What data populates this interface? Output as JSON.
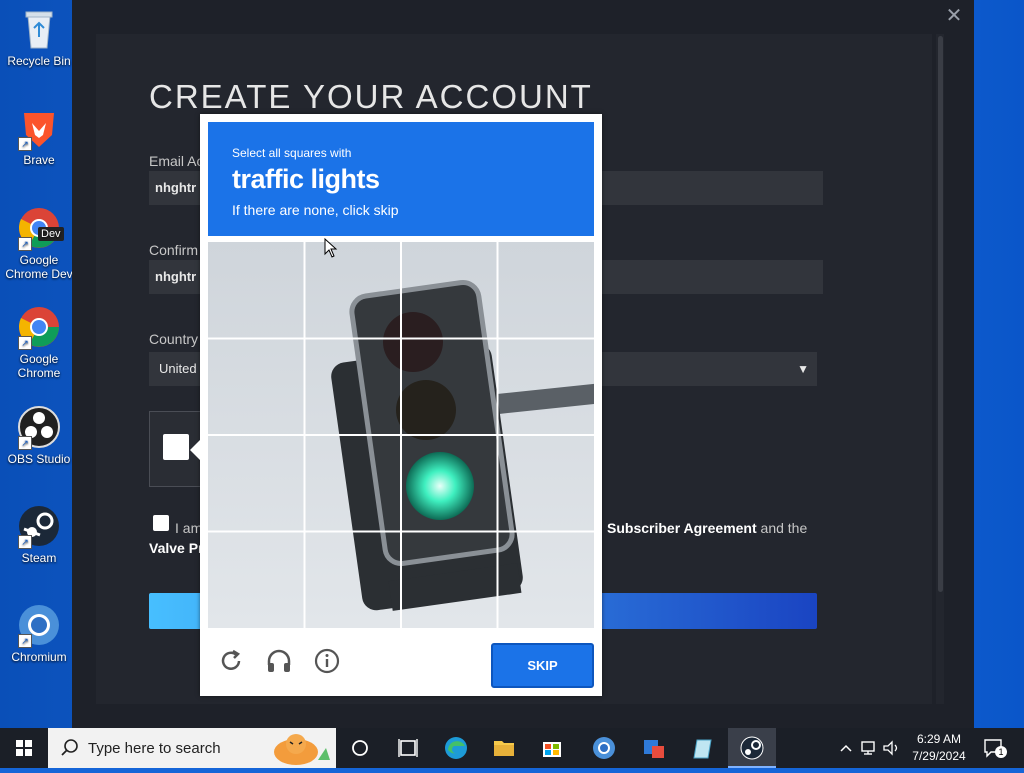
{
  "desktop": {
    "icons": [
      {
        "label_lines": [
          "Recycle Bin"
        ]
      },
      {
        "label_lines": [
          "Brave"
        ]
      },
      {
        "label_lines": [
          "Google",
          "Chrome Dev"
        ],
        "badge": "Dev"
      },
      {
        "label_lines": [
          "Google",
          "Chrome"
        ]
      },
      {
        "label_lines": [
          "OBS Studio"
        ]
      },
      {
        "label_lines": [
          "Steam"
        ]
      },
      {
        "label_lines": [
          "Chromium"
        ]
      }
    ]
  },
  "steam": {
    "title": "CREATE YOUR ACCOUNT",
    "email_label": "Email Ac",
    "email_value": "nhghtr",
    "confirm_label": "Confirm",
    "confirm_value": "nhghtr",
    "country_label": "Country",
    "country_value": "United",
    "agree_prefix": "I am",
    "agree_mid": "Subscriber Agreement",
    "agree_suffix": "and the",
    "agree_line2": "Valve Pr"
  },
  "captcha": {
    "instruction_small": "Select all squares with",
    "target": "traffic lights",
    "hint": "If there are none, click skip",
    "skip_label": "SKIP",
    "colors": {
      "prompt_bg": "#1b73e8",
      "green_light": "#3ff0c0"
    }
  },
  "taskbar": {
    "search_placeholder": "Type here to search",
    "time": "6:29 AM",
    "date": "7/29/2024",
    "notification_count": "1"
  }
}
